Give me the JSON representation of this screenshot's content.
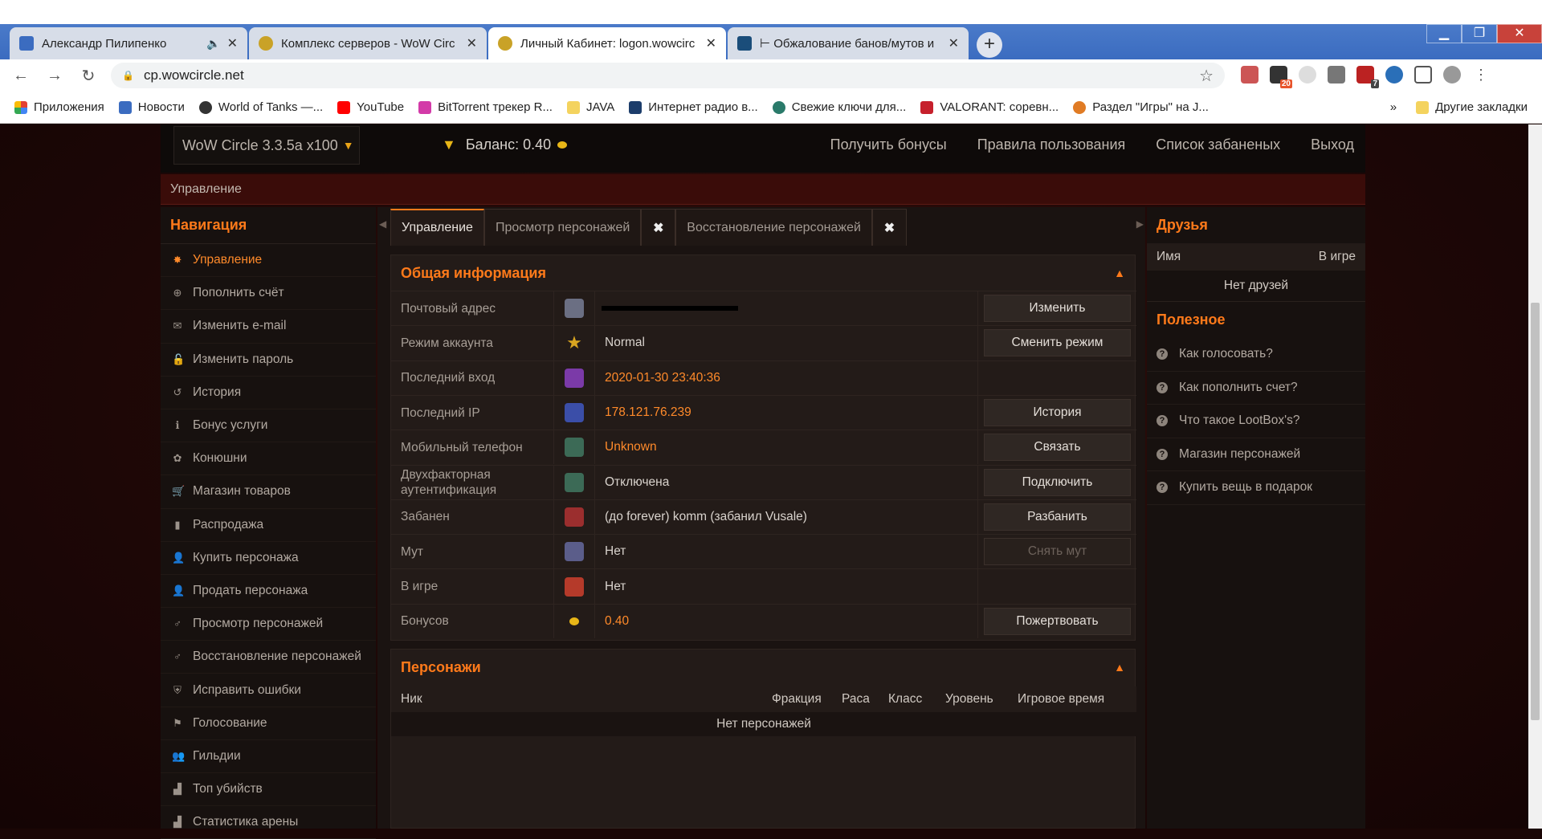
{
  "browser": {
    "tabs": [
      {
        "title": "Александр Пилипенко",
        "favicon_color": "#3b6cc0"
      },
      {
        "title": "Комплекс серверов - WoW Circ",
        "favicon_color": "#c9a227"
      },
      {
        "title": "Личный Кабинет: logon.wowcirc",
        "favicon_color": "#c9a227"
      },
      {
        "title": "⊢ Обжалование банов/мутов и",
        "favicon_color": "#1a4d7a"
      }
    ],
    "url": "cp.wowcircle.net",
    "ext_badge_1": "20",
    "ext_badge_2": "7",
    "bookmarks": [
      {
        "label": "Приложения",
        "color": "#e34133"
      },
      {
        "label": "Новости",
        "color": "#3b6cc0"
      },
      {
        "label": "World of Tanks —...",
        "color": "#333333"
      },
      {
        "label": "YouTube",
        "color": "#ff0000"
      },
      {
        "label": "BitTorrent трекер R...",
        "color": "#d33aa8"
      },
      {
        "label": "JAVA",
        "color": "#f4d35e"
      },
      {
        "label": "Интернет радио в...",
        "color": "#1c3d6b"
      },
      {
        "label": "Свежие ключи для...",
        "color": "#2a7a6a"
      },
      {
        "label": "VALORANT: соревн...",
        "color": "#c6202c"
      },
      {
        "label": "Раздел \"Игры\" на J...",
        "color": "#e07b24"
      }
    ],
    "bookmarks_more": "»",
    "other_bookmarks": "Другие закладки"
  },
  "site": {
    "realm": "WoW Circle 3.3.5a x100",
    "balance_label": "Баланс: 0.40",
    "topnav": [
      "Получить бонусы",
      "Правила пользования",
      "Список забаненых",
      "Выход"
    ],
    "breadcrumb": "Управление"
  },
  "leftnav": {
    "heading": "Навигация",
    "items": [
      {
        "label": "Управление",
        "icon": "gear-icon",
        "glyph": "✸"
      },
      {
        "label": "Пополнить счёт",
        "icon": "plus-circle-icon",
        "glyph": "⊕"
      },
      {
        "label": "Изменить e-mail",
        "icon": "envelope-icon",
        "glyph": "✉"
      },
      {
        "label": "Изменить пароль",
        "icon": "unlock-icon",
        "glyph": "🔓"
      },
      {
        "label": "История",
        "icon": "history-icon",
        "glyph": "↺"
      },
      {
        "label": "Бонус услуги",
        "icon": "info-icon",
        "glyph": "ℹ"
      },
      {
        "label": "Конюшни",
        "icon": "paw-icon",
        "glyph": "✿"
      },
      {
        "label": "Магазин товаров",
        "icon": "cart-icon",
        "glyph": "🛒"
      },
      {
        "label": "Распродажа",
        "icon": "bookmark-icon",
        "glyph": "▮"
      },
      {
        "label": "Купить персонажа",
        "icon": "user-icon",
        "glyph": "👤"
      },
      {
        "label": "Продать персонажа",
        "icon": "user-icon",
        "glyph": "👤"
      },
      {
        "label": "Просмотр персонажей",
        "icon": "male-icon",
        "glyph": "♂"
      },
      {
        "label": "Восстановление персонажей",
        "icon": "male-icon",
        "glyph": "♂"
      },
      {
        "label": "Исправить ошибки",
        "icon": "shield-icon",
        "glyph": "⛨"
      },
      {
        "label": "Голосование",
        "icon": "flag-icon",
        "glyph": "⚑"
      },
      {
        "label": "Гильдии",
        "icon": "users-icon",
        "glyph": "👥"
      },
      {
        "label": "Топ убийств",
        "icon": "area-chart-icon",
        "glyph": "▟"
      },
      {
        "label": "Статистика арены",
        "icon": "area-chart-icon",
        "glyph": "▟"
      }
    ]
  },
  "center": {
    "tabs": [
      "Управление",
      "Просмотр персонажей",
      "Восстановление персонажей"
    ],
    "tab_close": "✖",
    "info": {
      "title": "Общая информация",
      "rows": [
        {
          "label": "Почтовый адрес",
          "value": "",
          "button": "Изменить",
          "icon_color": "#6b6f83"
        },
        {
          "label": "Режим аккаунта",
          "value": "Normal",
          "button": "Сменить режим",
          "icon_color": "#d9a520"
        },
        {
          "label": "Последний вход",
          "value": "2020-01-30 23:40:36",
          "button": "",
          "icon_color": "#7b3aa8"
        },
        {
          "label": "Последний IP",
          "value": "178.121.76.239",
          "button": "История",
          "icon_color": "#3b4ea8"
        },
        {
          "label": "Мобильный телефон",
          "value": "Unknown",
          "button": "Связать",
          "icon_color": "#3c6a56"
        },
        {
          "label": "Двухфакторная аутентификация",
          "value": "Отключена",
          "button": "Подключить",
          "icon_color": "#3c6a56"
        },
        {
          "label": "Забанен",
          "value": "(до forever) komm (забанил Vusale)",
          "button": "Разбанить",
          "icon_color": "#9b2e2e"
        },
        {
          "label": "Мут",
          "value": "Нет",
          "button": "Снять мут",
          "icon_color": "#5b5d8a"
        },
        {
          "label": "В игре",
          "value": "Нет",
          "button": "",
          "icon_color": "#b53a2a"
        },
        {
          "label": "Бонусов",
          "value": "0.40",
          "button": "Пожертвовать",
          "icon_color": "#e8b617"
        }
      ]
    },
    "chars": {
      "title": "Персонажи",
      "columns": [
        "Ник",
        "Фракция",
        "Раса",
        "Класс",
        "Уровень",
        "Игровое время"
      ],
      "empty": "Нет персонажей"
    }
  },
  "right": {
    "friends_title": "Друзья",
    "col_name": "Имя",
    "col_ingame": "В игре",
    "friends_empty": "Нет друзей",
    "useful_title": "Полезное",
    "useful": [
      "Как голосовать?",
      "Как пополнить счет?",
      "Что такое LootBox's?",
      "Магазин персонажей",
      "Купить вещь в подарок"
    ]
  }
}
